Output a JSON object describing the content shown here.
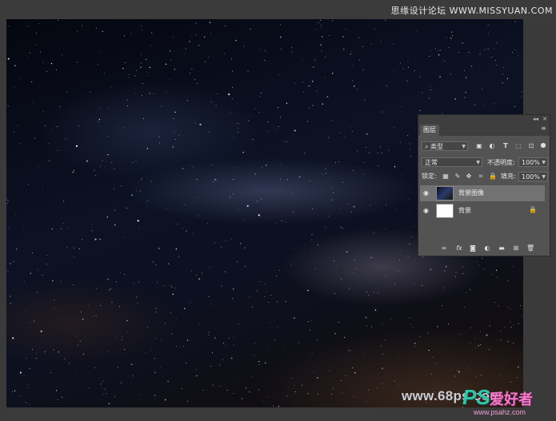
{
  "top_watermark": "思缘设计论坛 WWW.MISSYUAN.COM",
  "site_watermark": "www.68ps.com",
  "brand_logo": {
    "ps": "PS",
    "cn": "爱好者",
    "url": "www.psahz.com"
  },
  "panel": {
    "collapse_label": "◂◂",
    "close_label": "✕",
    "tab_label": "图层",
    "menu_icon": "menu-icon",
    "filter_kind": "类型",
    "blend_mode": "正常",
    "opacity_label": "不透明度:",
    "opacity_value": "100%",
    "lock_label": "锁定:",
    "fill_label": "填充:",
    "fill_value": "100%",
    "layers": [
      {
        "name": "背景图像",
        "selected": true,
        "locked": false
      },
      {
        "name": "背景",
        "selected": false,
        "locked": true
      }
    ],
    "bottom_icons": [
      "link-icon",
      "fx-icon",
      "mask-icon",
      "adjustment-icon",
      "folder-icon",
      "new-layer-icon",
      "trash-icon"
    ],
    "fx_text": "fx"
  },
  "colors": {
    "panel_bg": "#535353",
    "selected_layer": "#727272",
    "workspace": "#3a3a3a"
  }
}
